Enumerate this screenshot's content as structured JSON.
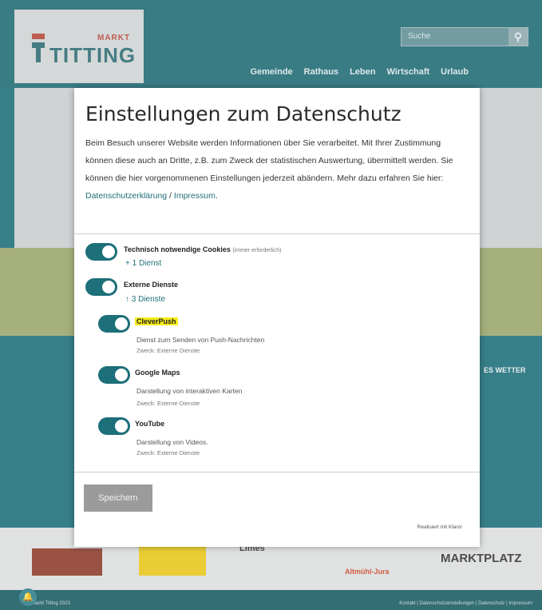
{
  "site": {
    "logo_small": "MARKT",
    "logo_name": "TITTING",
    "search_placeholder": "Suche",
    "nav": [
      "Gemeinde",
      "Rathaus",
      "Leben",
      "Wirtschaft",
      "Urlaub"
    ],
    "weather_heading": "ES WETTER",
    "partner_limes": "Limes",
    "partner_altmuehl": "Altmühl-Jura",
    "partner_markt": "MARKTPLATZ",
    "footer_left": "© Markt Titting 2023",
    "footer_right": "Kontakt | Datenschutzeinstellungen | Datenschutz | Impressum"
  },
  "modal": {
    "title": "Einstellungen zum Datenschutz",
    "intro": "Beim Besuch unserer Website werden Informationen über Sie verarbeitet. Mit Ihrer Zustimmung können diese auch an Dritte, z.B. zum Zweck der statistischen Auswertung, übermittelt werden. Sie können die hier vorgenommenen Einstellungen jederzeit abändern. Mehr dazu erfahren Sie hier:",
    "link_privacy": "Datenschutzerklärung",
    "link_sep": " / ",
    "link_imprint": "Impressum",
    "groups": [
      {
        "label": "Technisch notwendige Cookies",
        "note": "(immer erforderlich)",
        "services_link": "+ 1 Dienst",
        "enabled": true
      },
      {
        "label": "Externe Dienste",
        "note": "",
        "services_link": "↑ 3 Dienste",
        "enabled": true
      }
    ],
    "services": [
      {
        "name": "CleverPush",
        "description": "Dienst zum Senden von Push-Nachrichten",
        "purpose": "Zweck: Externe Dienste",
        "enabled": true,
        "highlighted": true
      },
      {
        "name": "Google Maps",
        "description": "Darstellung von interaktiven Karten",
        "purpose": "Zweck: Externe Dienste",
        "enabled": true,
        "highlighted": false
      },
      {
        "name": "YouTube",
        "description": "Darstellung von Videos.",
        "purpose": "Zweck: Externe Dienste",
        "enabled": true,
        "highlighted": false
      }
    ],
    "save_label": "Speichern",
    "credit": "Realisiert mit Klaro!"
  },
  "colors": {
    "accent": "#1d6f79",
    "highlight": "#f5ec1a",
    "header_bg": "#1f6a74"
  }
}
